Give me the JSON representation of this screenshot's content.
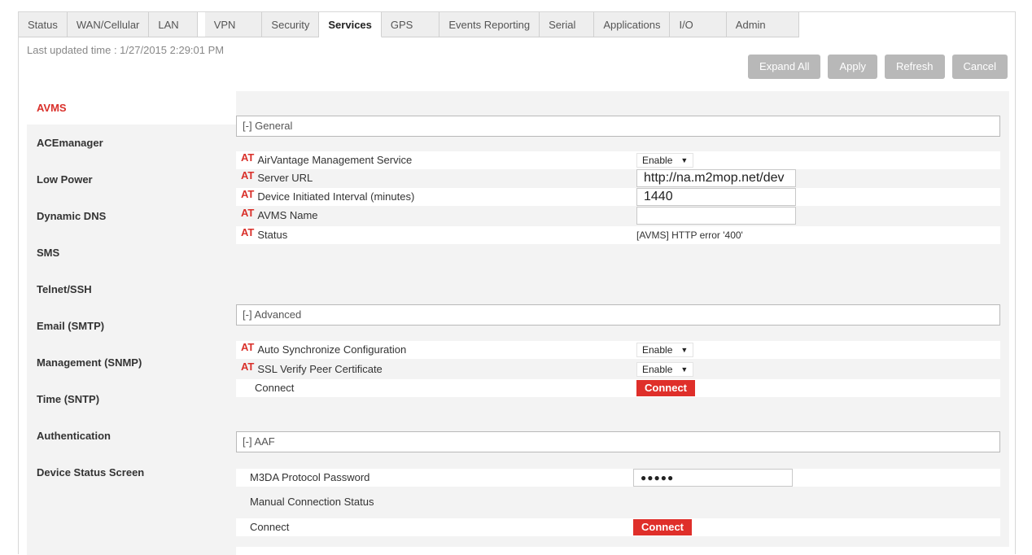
{
  "tabs": [
    {
      "label": "Status"
    },
    {
      "label": "WAN/Cellular"
    },
    {
      "label": "LAN"
    },
    {
      "label": "VPN"
    },
    {
      "label": "Security"
    },
    {
      "label": "Services"
    },
    {
      "label": "GPS"
    },
    {
      "label": "Events Reporting"
    },
    {
      "label": "Serial"
    },
    {
      "label": "Applications"
    },
    {
      "label": "I/O"
    },
    {
      "label": "Admin"
    }
  ],
  "active_tab": "Services",
  "last_updated": "Last updated time : 1/27/2015 2:29:01 PM",
  "toolbar": {
    "expand_all": "Expand All",
    "apply": "Apply",
    "refresh": "Refresh",
    "cancel": "Cancel"
  },
  "sidenav": [
    {
      "label": "AVMS"
    },
    {
      "label": "ACEmanager"
    },
    {
      "label": "Low Power"
    },
    {
      "label": "Dynamic DNS"
    },
    {
      "label": "SMS"
    },
    {
      "label": "Telnet/SSH"
    },
    {
      "label": "Email (SMTP)"
    },
    {
      "label": "Management (SNMP)"
    },
    {
      "label": "Time (SNTP)"
    },
    {
      "label": "Authentication"
    },
    {
      "label": "Device Status Screen"
    }
  ],
  "at_marker": "AT",
  "sections": {
    "general": {
      "title": "[-] General",
      "rows": [
        {
          "label": "AirVantage Management Service",
          "value": "Enable"
        },
        {
          "label": "Server URL",
          "value": "http://na.m2mop.net/dev"
        },
        {
          "label": "Device Initiated Interval (minutes)",
          "value": "1440"
        },
        {
          "label": "AVMS Name",
          "value": ""
        },
        {
          "label": "Status",
          "value": "[AVMS] HTTP error '400'"
        }
      ]
    },
    "advanced": {
      "title": "[-] Advanced",
      "rows": [
        {
          "label": "Auto Synchronize Configuration",
          "value": "Enable"
        },
        {
          "label": "SSL Verify Peer Certificate",
          "value": "Enable"
        },
        {
          "label": "Connect",
          "value": "Connect"
        }
      ]
    },
    "aaf": {
      "title": "[-] AAF",
      "rows": [
        {
          "label": "M3DA Protocol Password",
          "value": "●●●●●"
        },
        {
          "label": "Manual Connection Status",
          "value": ""
        },
        {
          "label": "Connect",
          "value": "Connect"
        }
      ]
    }
  },
  "colors": {
    "accent_red": "#df2f2a",
    "button_gray": "#b8b8b8",
    "panel_bg": "#f3f3f3"
  }
}
